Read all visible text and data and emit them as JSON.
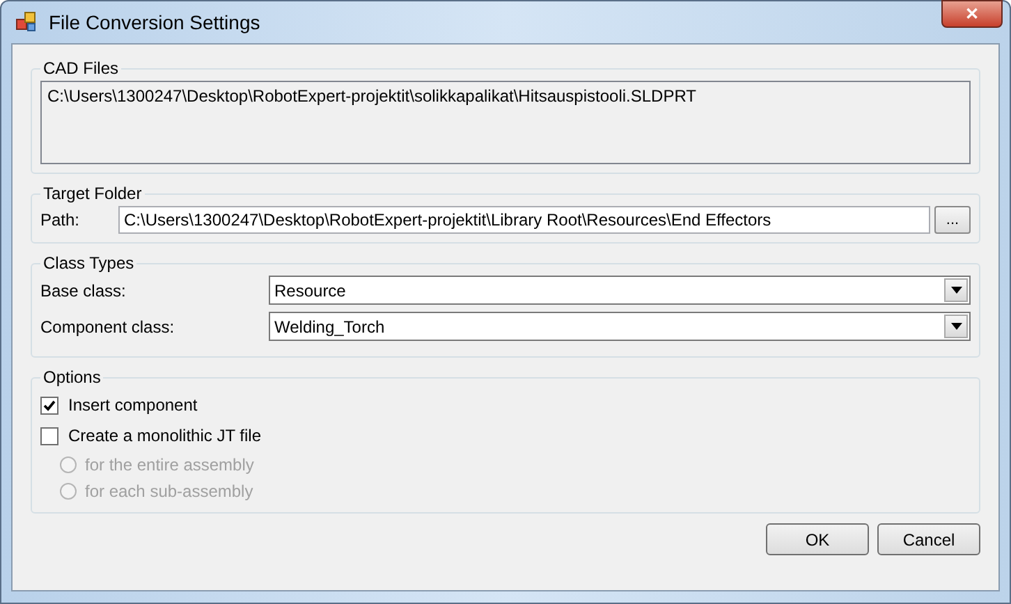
{
  "window": {
    "title": "File Conversion Settings",
    "close": "✕"
  },
  "cad_files": {
    "title": "CAD Files",
    "items": [
      "C:\\Users\\1300247\\Desktop\\RobotExpert-projektit\\solikkapalikat\\Hitsauspistooli.SLDPRT"
    ]
  },
  "target_folder": {
    "title": "Target Folder",
    "path_label": "Path:",
    "path": "C:\\Users\\1300247\\Desktop\\RobotExpert-projektit\\Library Root\\Resources\\End Effectors",
    "browse": "..."
  },
  "class_types": {
    "title": "Class Types",
    "fields": [
      {
        "label": "Base class:",
        "value": "Resource"
      },
      {
        "label": "Component class:",
        "value": "Welding_Torch"
      }
    ]
  },
  "options": {
    "title": "Options",
    "checkboxes": [
      {
        "label": "Insert component",
        "checked": true
      },
      {
        "label": "Create a monolithic JT file",
        "checked": false
      }
    ],
    "radios": [
      {
        "label": "for the entire assembly",
        "selected": false,
        "disabled": true
      },
      {
        "label": "for each sub-assembly",
        "selected": false,
        "disabled": true
      }
    ]
  },
  "buttons": [
    "OK",
    "Cancel"
  ]
}
